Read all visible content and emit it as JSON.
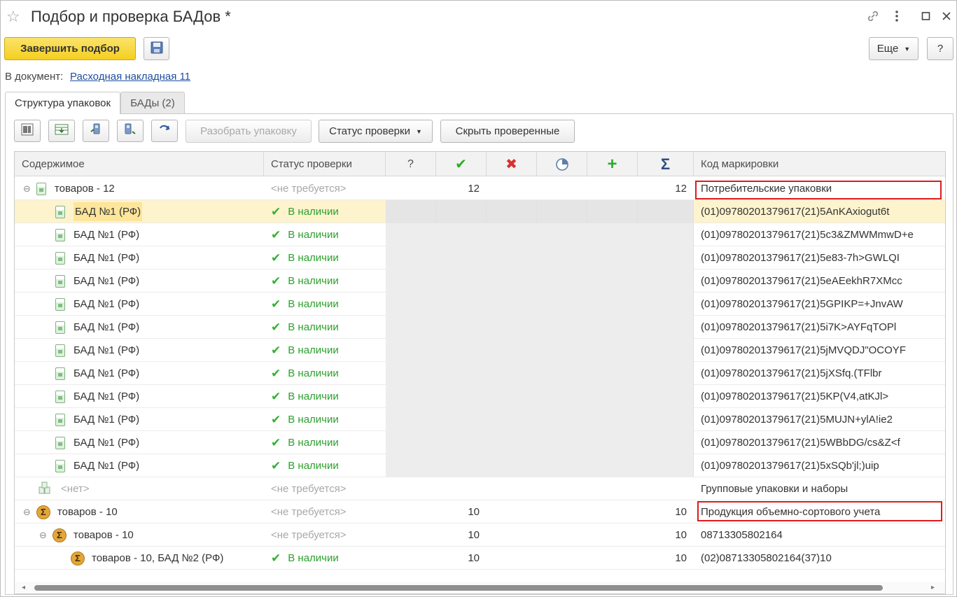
{
  "window": {
    "title": "Подбор и проверка БАДов *"
  },
  "toolbar": {
    "finish_label": "Завершить подбор",
    "more_label": "Еще",
    "help_label": "?"
  },
  "doc": {
    "label": "В документ:",
    "link": "Расходная накладная 11"
  },
  "tabs": [
    {
      "label": "Структура упаковок"
    },
    {
      "label": "БАДы (2)"
    }
  ],
  "grid_toolbar": {
    "unpack_label": "Разобрать упаковку",
    "status_label": "Статус проверки",
    "hide_label": "Скрыть проверенные"
  },
  "columns": {
    "content": "Содержимое",
    "status": "Статус проверки",
    "q": "?",
    "code": "Код маркировки"
  },
  "rows": [
    {
      "name": "товаров - 12",
      "status": "<не требуется>",
      "q": "12",
      "sum": "12",
      "code": "Потребительские упаковки"
    },
    {
      "name": "БАД №1 (РФ)",
      "status": "В наличии",
      "code": "(01)09780201379617(21)5AnKAxiogut6t"
    },
    {
      "name": "БАД №1 (РФ)",
      "status": "В наличии",
      "code": "(01)09780201379617(21)5c3&ZMWMmwD+e"
    },
    {
      "name": "БАД №1 (РФ)",
      "status": "В наличии",
      "code": "(01)09780201379617(21)5e83-7h>GWLQI"
    },
    {
      "name": "БАД №1 (РФ)",
      "status": "В наличии",
      "code": "(01)09780201379617(21)5eAEekhR7XMcc"
    },
    {
      "name": "БАД №1 (РФ)",
      "status": "В наличии",
      "code": "(01)09780201379617(21)5GPIKP=+JnvAW"
    },
    {
      "name": "БАД №1 (РФ)",
      "status": "В наличии",
      "code": "(01)09780201379617(21)5i7K>AYFqTOPl"
    },
    {
      "name": "БАД №1 (РФ)",
      "status": "В наличии",
      "code": "(01)09780201379617(21)5jMVQDJ\"OCOYF"
    },
    {
      "name": "БАД №1 (РФ)",
      "status": "В наличии",
      "code": "(01)09780201379617(21)5jXSfq.(TFlbr"
    },
    {
      "name": "БАД №1 (РФ)",
      "status": "В наличии",
      "code": "(01)09780201379617(21)5KP(V4,atKJl>"
    },
    {
      "name": "БАД №1 (РФ)",
      "status": "В наличии",
      "code": "(01)09780201379617(21)5MUJN+ylA!ie2"
    },
    {
      "name": "БАД №1 (РФ)",
      "status": "В наличии",
      "code": "(01)09780201379617(21)5WBbDG/cs&Z<f"
    },
    {
      "name": "БАД №1 (РФ)",
      "status": "В наличии",
      "code": "(01)09780201379617(21)5xSQb'jl;)uip"
    },
    {
      "name": "<нет>",
      "status": "<не требуется>",
      "code": "Групповые упаковки и наборы"
    },
    {
      "name": "товаров - 10",
      "status": "<не требуется>",
      "q": "10",
      "sum": "10",
      "code": "Продукция объемно-сортового учета"
    },
    {
      "name": "товаров - 10",
      "status": "<не требуется>",
      "q": "10",
      "sum": "10",
      "code": "08713305802164"
    },
    {
      "name": "товаров - 10, БАД №2 (РФ)",
      "status": "В наличии",
      "q": "10",
      "sum": "10",
      "code": "(02)08713305802164(37)10"
    }
  ],
  "colors": {
    "accent": "#f5cf20",
    "ok": "#2ea02e",
    "highlight_box": "#e01b1b",
    "selected_row": "#fdf3cd"
  }
}
